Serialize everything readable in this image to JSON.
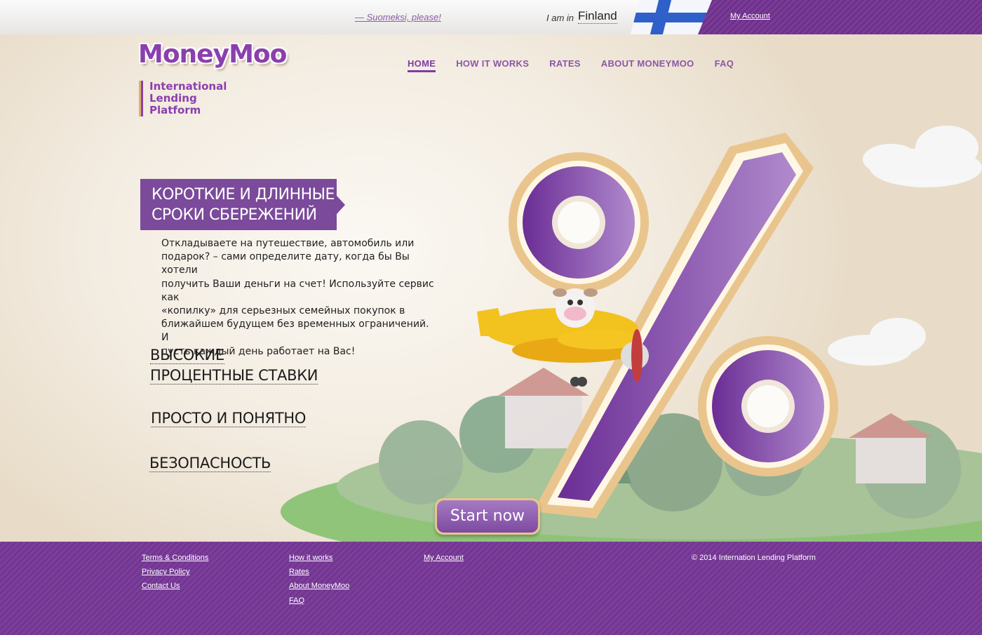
{
  "topbar": {
    "language_link": "— Suomeksi, please!",
    "location_prefix": "I am in",
    "country": "Finland",
    "account_link": "My Account"
  },
  "brand": {
    "logo_text": "MoneyMoo",
    "tagline": [
      "International",
      "Lending",
      "Platform"
    ]
  },
  "nav": [
    {
      "label": "HOME",
      "active": true
    },
    {
      "label": "HOW IT WORKS",
      "active": false
    },
    {
      "label": "RATES",
      "active": false
    },
    {
      "label": "ABOUT MONEYMOO",
      "active": false
    },
    {
      "label": "FAQ",
      "active": false
    }
  ],
  "hero": {
    "ribbon": [
      "КОРОТКИЕ И ДЛИННЫЕ",
      "СРОКИ СБЕРЕЖЕНИЙ"
    ],
    "description": [
      "Откладываете на путешествие, автомобиль или",
      "подарок? – сами определите дату, когда бы Вы хотели",
      "получить Ваши деньги на счет! Используйте сервис как",
      "«копилку» для серьезных семейных покупок в",
      "ближайшем будущем без временных ограничений. И",
      "пусть каждый день работает на Вас!"
    ],
    "features": [
      [
        "ВЫСОКИЕ",
        "ПРОЦЕНТНЫЕ СТАВКИ"
      ],
      [
        "ПРОСТО И ПОНЯТНО"
      ],
      [
        "БЕЗОПАСНОСТЬ"
      ]
    ],
    "cta": "Start now"
  },
  "footer": {
    "col1": [
      "Terms & Conditions",
      "Privacy Policy",
      "Contact Us"
    ],
    "col2": [
      "How it works",
      "Rates",
      "About MoneyMoo",
      "FAQ"
    ],
    "col3": [
      "My Account"
    ],
    "copyright": "© 2014 Internation Lending Platform"
  },
  "colors": {
    "brand_purple": "#7b4a9b",
    "gold": "#e9c58d",
    "flag_blue": "#2f5fc8"
  }
}
